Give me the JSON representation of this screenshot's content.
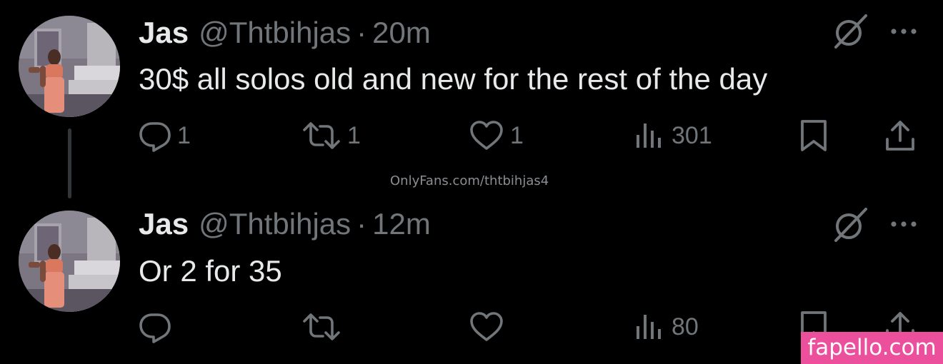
{
  "colors": {
    "background": "#000000",
    "primary_text": "#e7e9ea",
    "secondary_text": "#71767b",
    "thread_line": "#333639",
    "watermark_badge": "#ec4f9b"
  },
  "tweets": [
    {
      "display_name": "Jas",
      "handle": "@Thtbihjas",
      "separator": "·",
      "time": "20m",
      "text": "30$ all solos old and new for the rest of the day",
      "avatar_icon": "profile-photo",
      "actions": {
        "replies": "1",
        "reposts": "1",
        "likes": "1",
        "views": "301"
      }
    },
    {
      "display_name": "Jas",
      "handle": "@Thtbihjas",
      "separator": "·",
      "time": "12m",
      "text": "Or 2 for 35",
      "avatar_icon": "profile-photo",
      "actions": {
        "replies": "",
        "reposts": "",
        "likes": "",
        "views": "80"
      }
    }
  ],
  "icons": {
    "grok": "grok-icon",
    "more": "more-dots-icon",
    "reply": "reply-icon",
    "repost": "repost-icon",
    "like": "heart-icon",
    "views": "views-icon",
    "bookmark": "bookmark-icon",
    "share": "share-icon"
  },
  "watermarks": {
    "center": "OnlyFans.com/thtbihjas4",
    "corner": "fapello.com"
  }
}
